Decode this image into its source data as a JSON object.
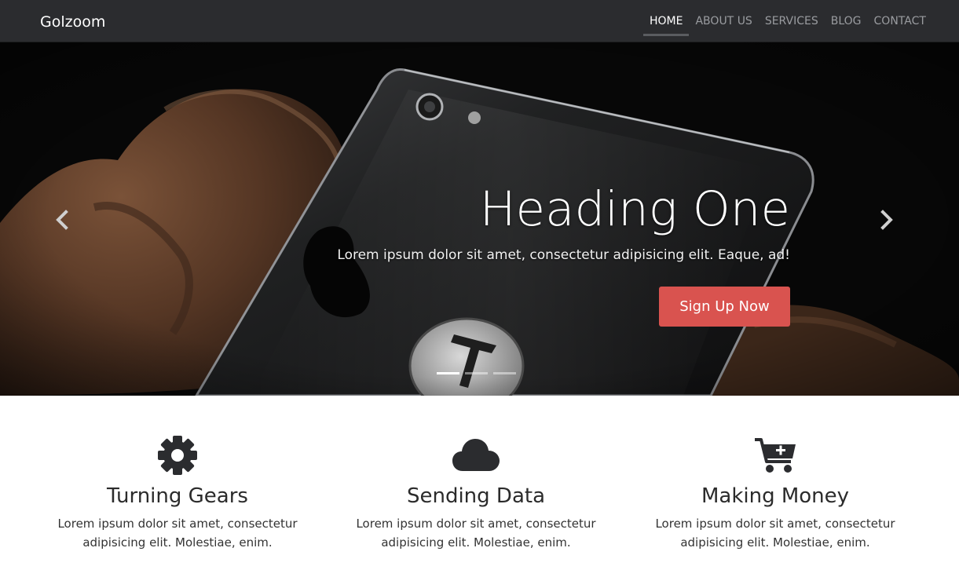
{
  "navbar": {
    "brand": "Golzoom",
    "items": [
      {
        "label": "HOME",
        "active": true
      },
      {
        "label": "ABOUT US",
        "active": false
      },
      {
        "label": "SERVICES",
        "active": false
      },
      {
        "label": "BLOG",
        "active": false
      },
      {
        "label": "CONTACT",
        "active": false
      }
    ]
  },
  "hero": {
    "heading": "Heading One",
    "subtitle": "Lorem ipsum dolor sit amet, consectetur adipisicing elit. Eaque, ad!",
    "cta_label": "Sign Up Now",
    "prev_icon": "chevron-left-icon",
    "next_icon": "chevron-right-icon",
    "slide_count": 3,
    "active_slide": 1
  },
  "features": [
    {
      "icon": "gear-icon",
      "title": "Turning Gears",
      "text": "Lorem ipsum dolor sit amet, consectetur adipisicing elit. Molestiae, enim."
    },
    {
      "icon": "cloud-icon",
      "title": "Sending Data",
      "text": "Lorem ipsum dolor sit amet, consectetur adipisicing elit. Molestiae, enim."
    },
    {
      "icon": "cart-plus-icon",
      "title": "Making Money",
      "text": "Lorem ipsum dolor sit amet, consectetur adipisicing elit. Molestiae, enim."
    }
  ],
  "colors": {
    "navbar_bg": "#2b2c2f",
    "cta_bg": "#d9534f",
    "icon_color": "#2b2c2f"
  }
}
